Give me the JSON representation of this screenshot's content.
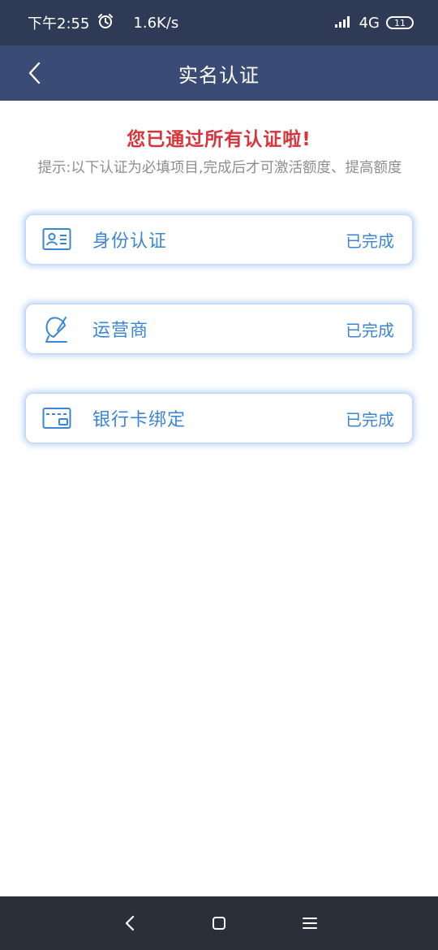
{
  "status_bar": {
    "time": "下午2:55",
    "speed": "1.6K/s",
    "network": "4G",
    "battery": "11",
    "icons": [
      "alarm-icon",
      "signal-icon",
      "battery-icon"
    ]
  },
  "nav": {
    "title": "实名认证",
    "back_icon": "chevron-left-icon"
  },
  "main": {
    "headline": "您已通过所有认证啦!",
    "hint": "提示:以下认证为必填项目,完成后才可激活额度、提高额度",
    "cards": [
      {
        "label": "身份认证",
        "status": "已完成",
        "icon": "id-card-icon"
      },
      {
        "label": "运营商",
        "status": "已完成",
        "icon": "carrier-dish-icon"
      },
      {
        "label": "银行卡绑定",
        "status": "已完成",
        "icon": "bank-card-icon"
      }
    ]
  },
  "system_nav": {
    "buttons": [
      "back-icon",
      "home-icon",
      "menu-icon"
    ]
  },
  "colors": {
    "status_bar_bg": "#2f3a57",
    "nav_bar_bg": "#3a4b75",
    "headline": "#d8343b",
    "accent": "#3a86d6",
    "hint": "#8e8e8e",
    "system_nav_bg": "#2b2f3a"
  }
}
